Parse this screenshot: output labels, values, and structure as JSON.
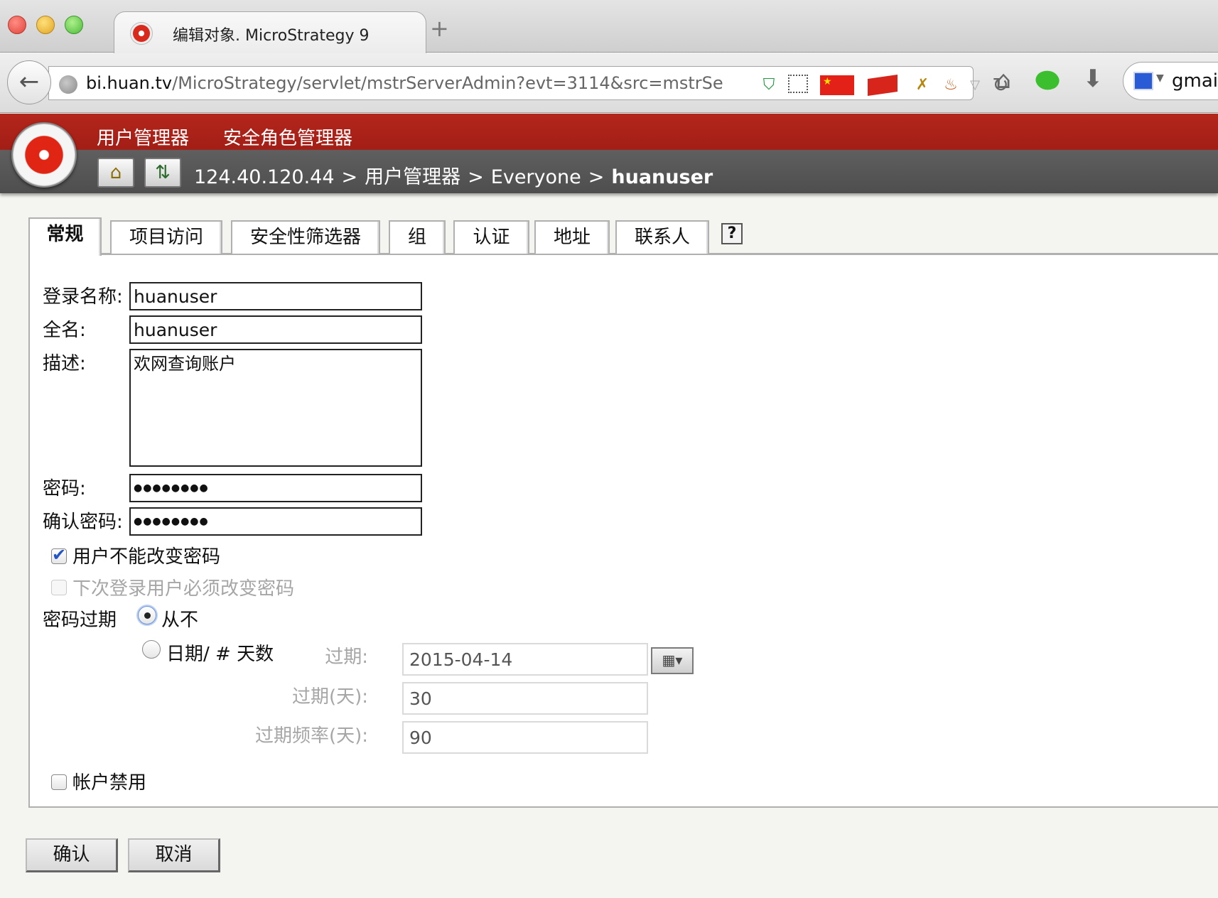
{
  "browser": {
    "tab_title": "编辑对象. MicroStrategy 9",
    "new_tab": "+",
    "url_host": "bi.huan.tv",
    "url_path": "/MicroStrategy/servlet/mstrServerAdmin?evt=3114&src=mstrSe",
    "search_text": "gmail"
  },
  "app": {
    "menu": {
      "user_manager": "用户管理器",
      "role_manager": "安全角色管理器"
    },
    "breadcrumb": {
      "server": "124.40.120.44",
      "sep": ">",
      "level1": "用户管理器",
      "level2": "Everyone",
      "current": "huanuser"
    }
  },
  "tabs": [
    {
      "label": "常规",
      "active": true
    },
    {
      "label": "项目访问"
    },
    {
      "label": "安全性筛选器"
    },
    {
      "label": "组"
    },
    {
      "label": "认证"
    },
    {
      "label": "地址"
    },
    {
      "label": "联系人"
    }
  ],
  "help_label": "?",
  "form": {
    "login_label": "登录名称:",
    "login_value": "huanuser",
    "fullname_label": "全名:",
    "fullname_value": "huanuser",
    "desc_label": "描述:",
    "desc_value": "欢网查询账户",
    "password_label": "密码:",
    "password_value": "●●●●●●●●",
    "confirm_label": "确认密码:",
    "confirm_value": "●●●●●●●●",
    "cannot_change_label": "用户不能改变密码",
    "cannot_change_checked": true,
    "must_change_label": "下次登录用户必须改变密码",
    "must_change_checked": false,
    "expire_label": "密码过期",
    "never_label": "从不",
    "datedays_label": "日期/ # 天数",
    "expire_date_label": "过期:",
    "expire_date_value": "2015-04-14",
    "expire_days_label": "过期(天):",
    "expire_days_value": "30",
    "expire_freq_label": "过期频率(天):",
    "expire_freq_value": "90",
    "disabled_label": "帐户禁用",
    "disabled_checked": false
  },
  "actions": {
    "ok": "确认",
    "cancel": "取消"
  },
  "colors": {
    "header_red": "#b3261c",
    "header_gray": "#555555",
    "check_blue": "#2454c8"
  }
}
